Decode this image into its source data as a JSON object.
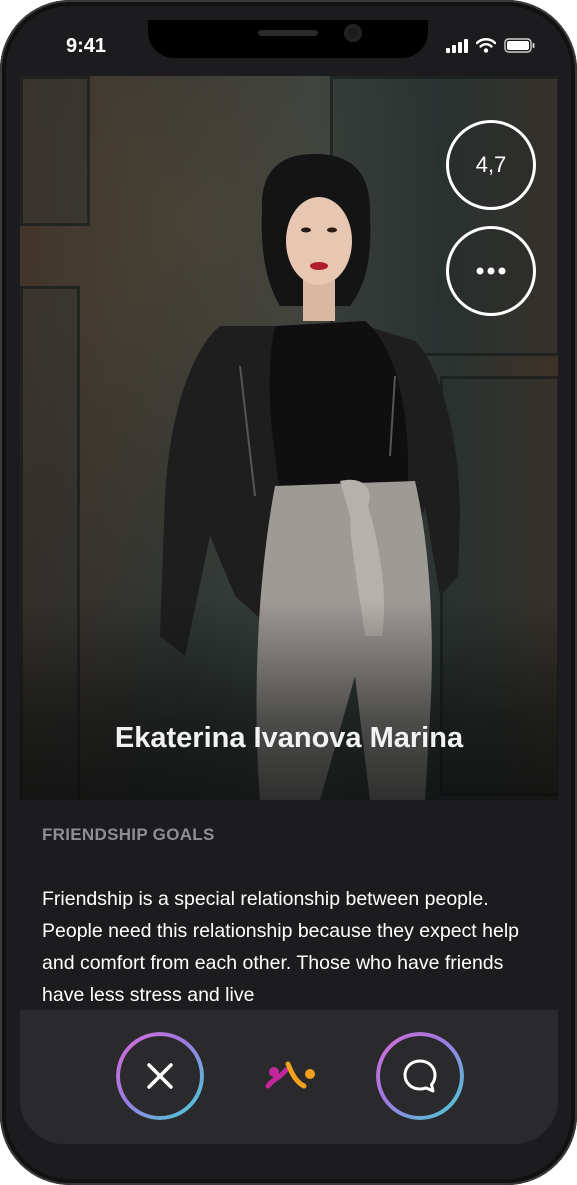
{
  "status_bar": {
    "time": "9:41"
  },
  "profile": {
    "name": "Ekaterina Ivanova Marina",
    "rating": "4,7"
  },
  "section": {
    "title": "FRIENDSHIP GOALS",
    "body": "Friendship is a special relationship between people. People need this relationship because they expect help and comfort from each other. Those who have friends have less stress and live"
  },
  "icons": {
    "more": "more-icon",
    "dismiss": "close-icon",
    "chat": "chat-bubble-icon",
    "logo": "app-logo-icon",
    "signal": "signal-icon",
    "wifi": "wifi-icon",
    "battery": "battery-icon"
  },
  "colors": {
    "gradient_start": "#d96bd9",
    "gradient_mid": "#9b7be0",
    "gradient_end": "#40d4d4",
    "logo_pink": "#c2279b",
    "logo_orange": "#f0a21e",
    "background": "#1c1c1e"
  }
}
